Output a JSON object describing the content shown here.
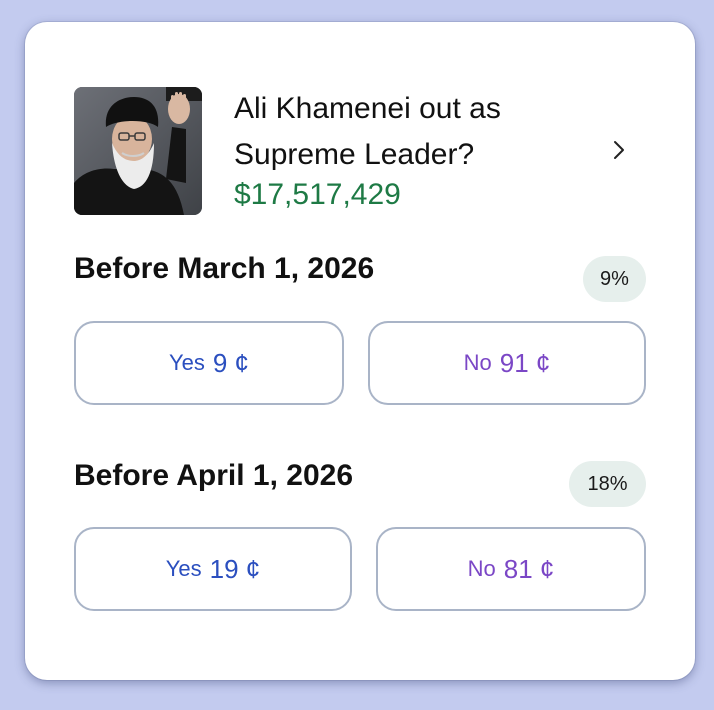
{
  "market": {
    "title": "Ali Khamenei out as Supreme Leader?",
    "volume": "$17,517,429",
    "chevron_icon": "chevron-right-icon",
    "avatar_icon": "person-photo"
  },
  "outcomes": [
    {
      "label": "Before March 1, 2026",
      "probability": "9%",
      "yes_label": "Yes",
      "yes_price": "9 ¢",
      "no_label": "No",
      "no_price": "91 ¢"
    },
    {
      "label": "Before April 1, 2026",
      "probability": "18%",
      "yes_label": "Yes",
      "yes_price": "19 ¢",
      "no_label": "No",
      "no_price": "81 ¢"
    }
  ],
  "colors": {
    "background": "#c3cbef",
    "volume": "#1e7a45",
    "yes": "#2b4fbf",
    "no": "#7b47c6",
    "badge": "#e6efec"
  }
}
